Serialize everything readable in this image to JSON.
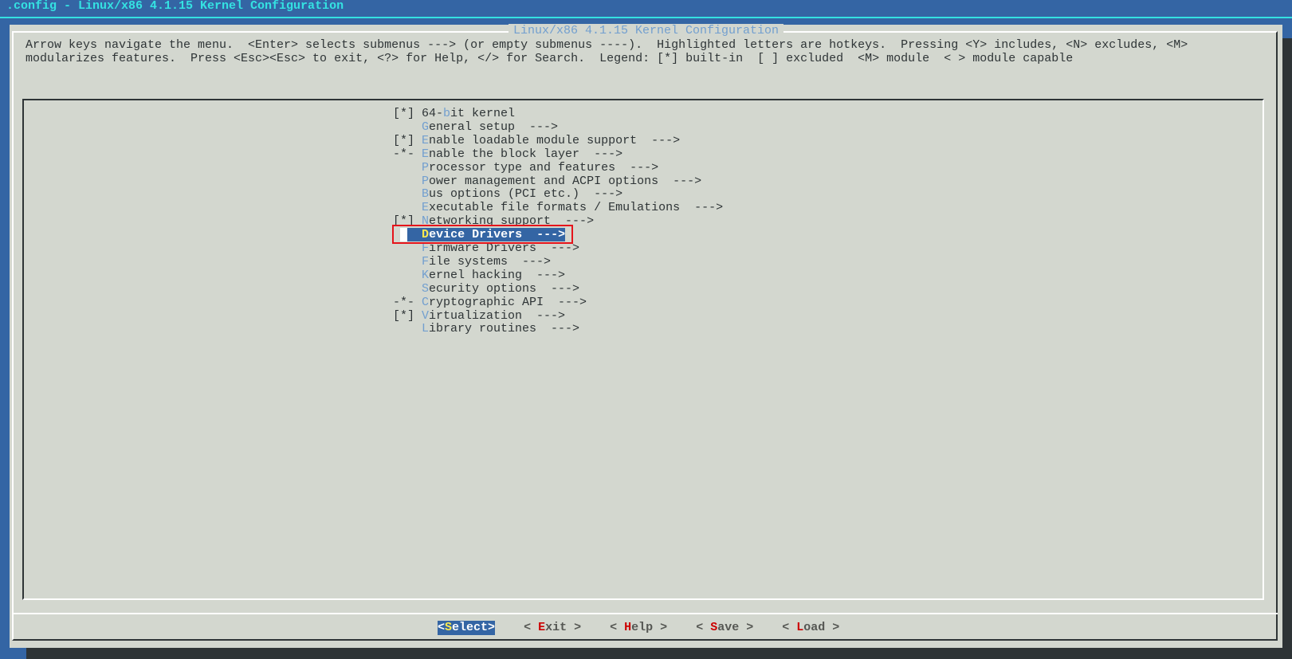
{
  "window": {
    "title": ".config - Linux/x86 4.1.15 Kernel Configuration"
  },
  "dialog": {
    "title": "Linux/x86 4.1.15 Kernel Configuration",
    "help_lines": [
      "Arrow keys navigate the menu.  <Enter> selects submenus ---> (or empty submenus ----).  Highlighted letters are hotkeys.  Pressing <Y> includes, <N> excludes, <M>",
      "modularizes features.  Press <Esc><Esc> to exit, <?> for Help, </> for Search.  Legend: [*] built-in  [ ] excluded  <M> module  < > module capable"
    ]
  },
  "menu": {
    "selected_index": 9,
    "items": [
      {
        "prefix": "[*] ",
        "before": "64-",
        "hotkey": "b",
        "rest": "it kernel"
      },
      {
        "prefix": "    ",
        "before": "",
        "hotkey": "G",
        "rest": "eneral setup  --->"
      },
      {
        "prefix": "[*] ",
        "before": "",
        "hotkey": "E",
        "rest": "nable loadable module support  --->"
      },
      {
        "prefix": "-*- ",
        "before": "",
        "hotkey": "E",
        "rest": "nable the block layer  --->"
      },
      {
        "prefix": "    ",
        "before": "",
        "hotkey": "P",
        "rest": "rocessor type and features  --->"
      },
      {
        "prefix": "    ",
        "before": "",
        "hotkey": "P",
        "rest": "ower management and ACPI options  --->"
      },
      {
        "prefix": "    ",
        "before": "",
        "hotkey": "B",
        "rest": "us options (PCI etc.)  --->"
      },
      {
        "prefix": "    ",
        "before": "",
        "hotkey": "E",
        "rest": "xecutable file formats / Emulations  --->"
      },
      {
        "prefix": "[*] ",
        "before": "",
        "hotkey": "N",
        "rest": "etworking support  --->"
      },
      {
        "prefix": "    ",
        "before": "",
        "hotkey": "D",
        "rest": "evice Drivers  --->"
      },
      {
        "prefix": "    ",
        "before": "",
        "hotkey": "F",
        "rest": "irmware Drivers  --->"
      },
      {
        "prefix": "    ",
        "before": "",
        "hotkey": "F",
        "rest": "ile systems  --->"
      },
      {
        "prefix": "    ",
        "before": "",
        "hotkey": "K",
        "rest": "ernel hacking  --->"
      },
      {
        "prefix": "    ",
        "before": "",
        "hotkey": "S",
        "rest": "ecurity options  --->"
      },
      {
        "prefix": "-*- ",
        "before": "",
        "hotkey": "C",
        "rest": "ryptographic API  --->"
      },
      {
        "prefix": "[*] ",
        "before": "",
        "hotkey": "V",
        "rest": "irtualization  --->"
      },
      {
        "prefix": "    ",
        "before": "",
        "hotkey": "L",
        "rest": "ibrary routines  --->"
      }
    ]
  },
  "buttons": [
    {
      "left": "<",
      "hotkey": "S",
      "rest": "elect",
      "right": ">",
      "active": true
    },
    {
      "left": "< ",
      "hotkey": "E",
      "rest": "xit",
      "right": " >",
      "active": false
    },
    {
      "left": "< ",
      "hotkey": "H",
      "rest": "elp",
      "right": " >",
      "active": false
    },
    {
      "left": "< ",
      "hotkey": "S",
      "rest": "ave",
      "right": " >",
      "active": false
    },
    {
      "left": "< ",
      "hotkey": "L",
      "rest": "oad",
      "right": " >",
      "active": false
    }
  ],
  "colors": {
    "background": "#3465a4",
    "dialog": "#d3d7cf",
    "hotkey": "#729fcf",
    "highlight": "#3465a4",
    "annotation_box": "#e5141b"
  }
}
